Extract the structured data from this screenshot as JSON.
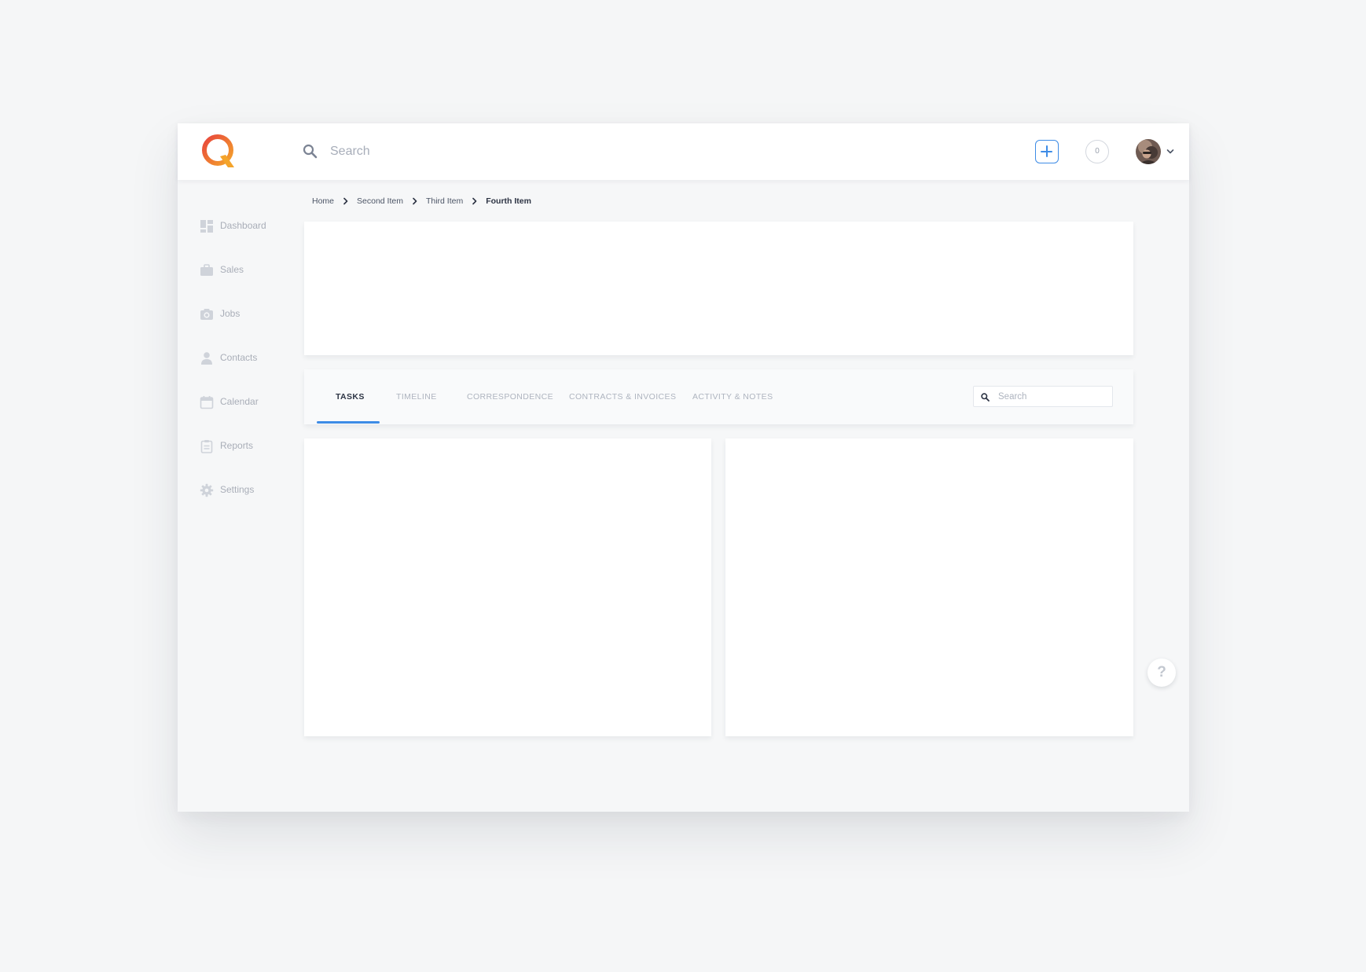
{
  "header": {
    "logo_icon": "q-logo",
    "search": {
      "icon": "search-icon",
      "placeholder": "Search",
      "value": ""
    },
    "add_icon": "plus-icon",
    "notifications": {
      "count": "0"
    },
    "avatar_icon": "user-avatar",
    "menu_icon": "chevron-down-icon"
  },
  "sidebar": {
    "items": [
      {
        "label": "Dashboard",
        "icon": "dashboard-icon"
      },
      {
        "label": "Sales",
        "icon": "briefcase-icon"
      },
      {
        "label": "Jobs",
        "icon": "camera-icon"
      },
      {
        "label": "Contacts",
        "icon": "person-icon"
      },
      {
        "label": "Calendar",
        "icon": "calendar-icon"
      },
      {
        "label": "Reports",
        "icon": "clipboard-icon"
      },
      {
        "label": "Settings",
        "icon": "gear-icon"
      }
    ]
  },
  "breadcrumb": {
    "items": [
      "Home",
      "Second Item",
      "Third Item",
      "Fourth Item"
    ]
  },
  "tabs": {
    "items": [
      {
        "label": "TASKS",
        "active": true
      },
      {
        "label": "TIMELINE",
        "active": false
      },
      {
        "label": "CORRESPONDENCE",
        "active": false
      },
      {
        "label": "CONTRACTS & INVOICES",
        "active": false
      },
      {
        "label": "ACTIVITY & NOTES",
        "active": false
      }
    ],
    "search": {
      "placeholder": "Search",
      "value": ""
    }
  },
  "help": {
    "label": "?"
  },
  "colors": {
    "accent": "#3e8ce6",
    "logo_red": "#e8453c",
    "logo_orange": "#f4a42b",
    "background": "#f6f7f8",
    "text_muted": "#a9aeb8",
    "text_dark": "#2d3444"
  }
}
